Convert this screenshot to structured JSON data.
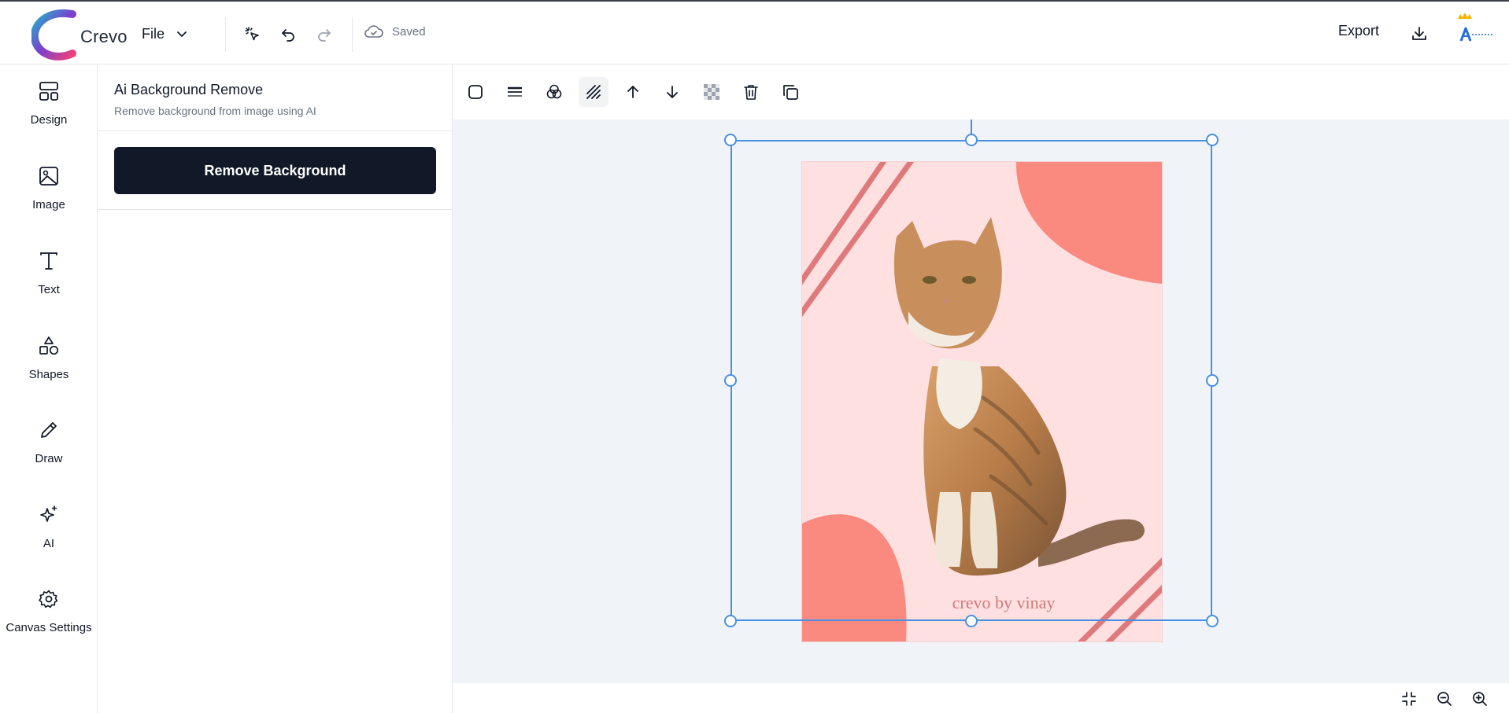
{
  "header": {
    "logo_text": "Crevo",
    "file_label": "File",
    "saved_label": "Saved",
    "export_label": "Export",
    "icons": {
      "logo": "crevo-logo",
      "file_chevron": "chevron-down-icon",
      "select": "pointer-sparkle-icon",
      "undo": "undo-icon",
      "redo": "redo-icon",
      "saved": "cloud-check-icon",
      "download": "download-icon",
      "avatar": "akshar-crown-avatar"
    }
  },
  "rail": {
    "items": [
      {
        "label": "Design",
        "icon": "layout-icon"
      },
      {
        "label": "Image",
        "icon": "image-icon"
      },
      {
        "label": "Text",
        "icon": "text-icon"
      },
      {
        "label": "Shapes",
        "icon": "shapes-icon"
      },
      {
        "label": "Draw",
        "icon": "pencil-icon"
      },
      {
        "label": "AI",
        "icon": "sparkles-icon"
      },
      {
        "label": "Canvas Settings",
        "icon": "gear-icon"
      }
    ]
  },
  "panel": {
    "title": "Ai Background Remove",
    "subtitle": "Remove background from image using AI",
    "action_label": "Remove Background",
    "collapse_icon": "chevrons-left-icon"
  },
  "toolbar": {
    "tools": [
      {
        "name": "border-radius",
        "icon": "square-rounded-icon",
        "active": false
      },
      {
        "name": "stroke-lines",
        "icon": "lines-icon",
        "active": false
      },
      {
        "name": "blend",
        "icon": "circles-overlap-icon",
        "active": false
      },
      {
        "name": "pattern",
        "icon": "hatch-icon",
        "active": true
      },
      {
        "name": "bring-forward",
        "icon": "arrow-up-icon",
        "active": false
      },
      {
        "name": "send-backward",
        "icon": "arrow-down-icon",
        "active": false
      },
      {
        "name": "transparency",
        "icon": "checkerboard-icon",
        "active": false
      },
      {
        "name": "delete",
        "icon": "trash-icon",
        "active": false
      },
      {
        "name": "duplicate",
        "icon": "copy-icon",
        "active": false
      }
    ]
  },
  "canvas": {
    "watermark_text": "crevo by vinay",
    "background_color": "#ffe0e0",
    "accent_color": "#fa8a80",
    "stripe_color": "#df7a7c",
    "selection_color": "#4a90e2",
    "image_subject": "cat-photo"
  },
  "zoom": {
    "icons": [
      "fit-screen-icon",
      "zoom-out-icon",
      "zoom-in-icon"
    ]
  }
}
